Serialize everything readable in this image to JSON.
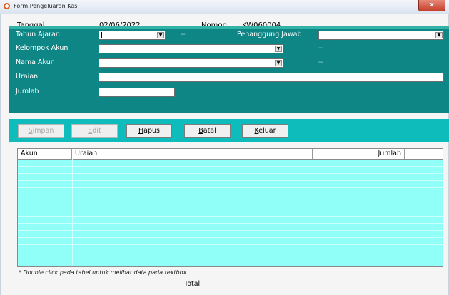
{
  "window": {
    "title": "Form Pengeluaran Kas",
    "close_label": "x"
  },
  "header": {
    "tanggal_label": "Tanggal",
    "tanggal_value": "02/06/2022",
    "nomor_label": "Nomor:",
    "nomor_value": "KW060004"
  },
  "form": {
    "tahun_ajaran_label": "Tahun Ajaran",
    "tahun_ajaran_value": "",
    "tahun_ajaran_extra": "--",
    "penanggung_jawab_label": "Penanggung Jawab",
    "penanggung_jawab_value": "",
    "kelompok_akun_label": "Kelompok Akun",
    "kelompok_akun_value": "",
    "kelompok_akun_extra": "--",
    "nama_akun_label": "Nama Akun",
    "nama_akun_value": "",
    "nama_akun_extra": "--",
    "uraian_label": "Uraian",
    "uraian_value": "",
    "jumlah_label": "Jumlah",
    "jumlah_value": ""
  },
  "buttons": {
    "simpan": {
      "pre": "",
      "key": "S",
      "post": "impan",
      "enabled": false
    },
    "edit": {
      "pre": "",
      "key": "E",
      "post": "dit",
      "enabled": false
    },
    "hapus": {
      "pre": "",
      "key": "H",
      "post": "apus",
      "enabled": true
    },
    "batal": {
      "pre": "",
      "key": "B",
      "post": "atal",
      "enabled": true
    },
    "keluar": {
      "pre": "",
      "key": "K",
      "post": "eluar",
      "enabled": true
    }
  },
  "table": {
    "columns": [
      "Akun",
      "Uraian",
      "Jumlah",
      ""
    ],
    "rows": []
  },
  "footer": {
    "note": "* Double click pada tabel untuk melihat data pada textbox",
    "total_label": "Total"
  },
  "colors": {
    "panel": "#0f8686",
    "button_bar": "#0fbcbc",
    "grid": "#8ffff7"
  },
  "icons": {
    "app": "app-circle-icon",
    "dropdown": "dropdown-arrow-icon"
  }
}
